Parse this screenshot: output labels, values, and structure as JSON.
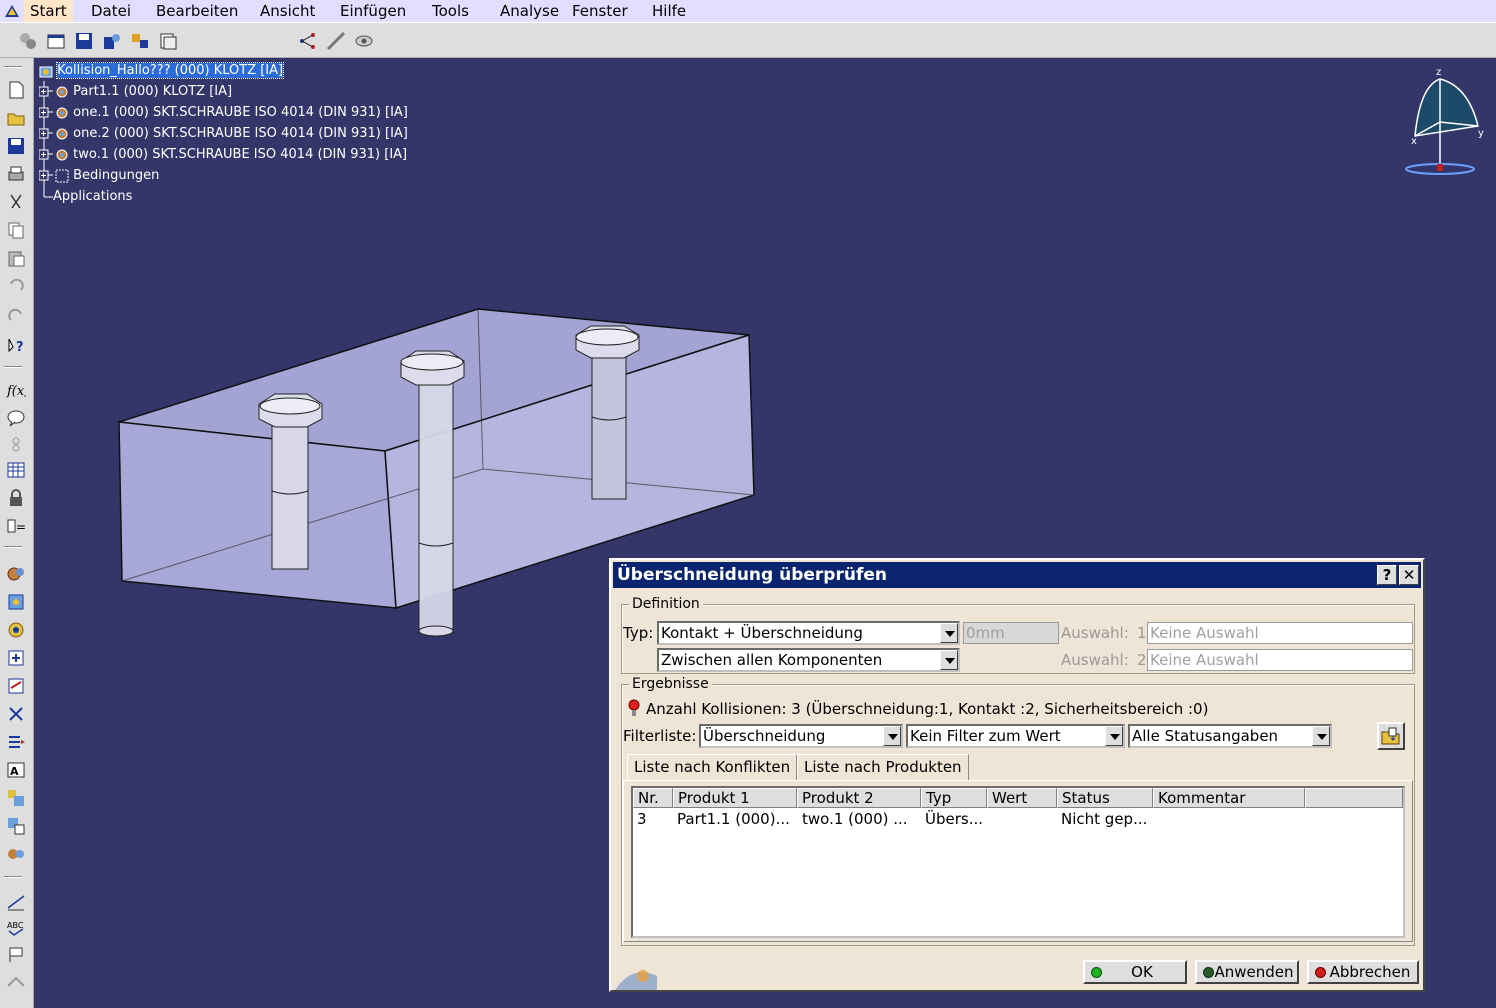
{
  "menu": {
    "items": [
      "Start",
      "Datei",
      "Bearbeiten",
      "Ansicht",
      "Einfügen",
      "Tools",
      "Analyse",
      "Fenster",
      "Hilfe"
    ]
  },
  "tree": {
    "root": "Kollision_Hallo??? (000) KLOTZ [IA]",
    "items": [
      "Part1.1 (000) KLOTZ [IA]",
      "one.1 (000) SKT.SCHRAUBE ISO 4014 (DIN 931) [IA]",
      "one.2 (000) SKT.SCHRAUBE ISO 4014 (DIN 931) [IA]",
      "two.1 (000) SKT.SCHRAUBE ISO 4014 (DIN 931) [IA]",
      "Bedingungen",
      "Applications"
    ]
  },
  "compass": {
    "z": "z",
    "x": "x",
    "y": "y"
  },
  "dialog": {
    "title": "Überschneidung überprüfen",
    "help_label": "?",
    "close_label": "✕",
    "definition": {
      "legend": "Definition",
      "typ_label": "Typ:",
      "typ_value": "Kontakt + Überschneidung",
      "clearance_value": "0mm",
      "mode_value": "Zwischen allen Komponenten",
      "auswahl_label": "Auswahl:",
      "auswahl1_num": "1",
      "auswahl2_num": "2",
      "auswahl1_value": "Keine Auswahl",
      "auswahl2_value": "Keine Auswahl"
    },
    "results": {
      "legend": "Ergebnisse",
      "summary": "Anzahl Kollisionen: 3 (Überschneidung:1, Kontakt        :2, Sicherheitsbereich :0)",
      "filter_label": "Filterliste:",
      "filter1": "Überschneidung",
      "filter2": "Kein Filter zum Wert",
      "filter3": "Alle Statusangaben",
      "tabs": [
        "Liste nach Konflikten",
        "Liste nach Produkten"
      ],
      "columns": [
        "Nr.",
        "Produkt 1",
        "Produkt 2",
        "Typ",
        "Wert",
        "Status",
        "Kommentar"
      ],
      "rows": [
        [
          "3",
          "Part1.1 (000)...",
          "two.1 (000) ...",
          "Übers...",
          "",
          "Nicht gep...",
          ""
        ]
      ]
    },
    "buttons": {
      "ok": "OK",
      "apply": "Anwenden",
      "cancel": "Abbrechen"
    }
  },
  "colors": {
    "background": "#34366a",
    "dialog_title": "#0a2470",
    "dialog_bg": "#efe5d6",
    "selection": "#2b6cd8"
  }
}
